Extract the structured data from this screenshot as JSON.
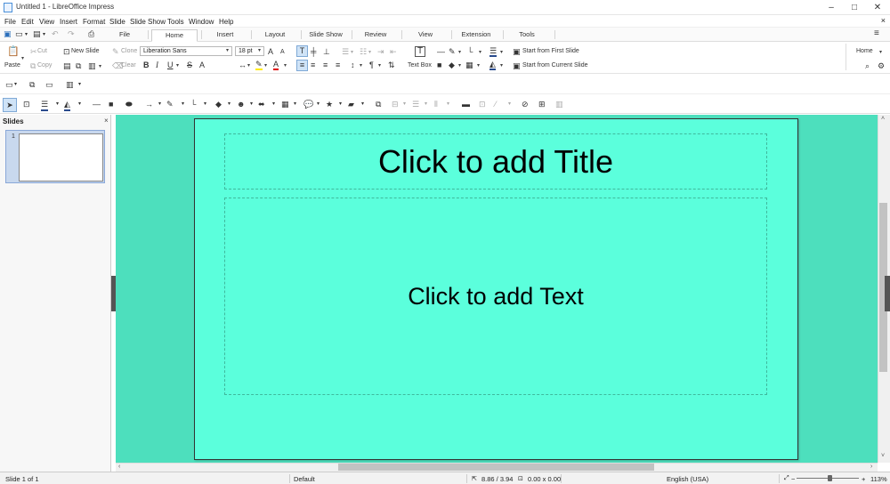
{
  "window": {
    "title": "Untitled 1 - LibreOffice Impress",
    "minimize": "–",
    "maximize": "□",
    "close": "✕"
  },
  "menu": {
    "items": [
      "File",
      "Edit",
      "View",
      "Insert",
      "Format",
      "Slide",
      "Slide Show",
      "Tools",
      "Window",
      "Help"
    ],
    "close_doc": "×"
  },
  "tabs": {
    "items": [
      "File",
      "Home",
      "Insert",
      "Layout",
      "Slide Show",
      "Review",
      "View",
      "Extension",
      "Tools"
    ],
    "active": "Home"
  },
  "ribbon": {
    "paste": "Paste",
    "cut": "Cut",
    "copy": "Copy",
    "new_slide": "New Slide",
    "clone": "Clone",
    "clear": "Clear",
    "font_name": "Liberation Sans",
    "font_size": "18 pt",
    "text_box": "Text Box",
    "start_first": "Start from First Slide",
    "start_current": "Start from Current Slide",
    "home_select": "Home"
  },
  "slides_pane": {
    "header": "Slides",
    "close": "×",
    "slide_number": "1"
  },
  "slide": {
    "title_placeholder": "Click to add Title",
    "body_placeholder": "Click to add Text"
  },
  "status": {
    "slide": "Slide 1 of 1",
    "layout": "Default",
    "position": "8.86 / 3.94",
    "size": "0.00 x 0.00",
    "language": "English (USA)",
    "zoom_minus": "−",
    "zoom_plus": "+",
    "zoom": "113%"
  },
  "colors": {
    "workspace": "#4ddfbd",
    "slide_bg": "#5bffdc",
    "placeholder_border": "#3fb99c"
  },
  "icons": [
    "search-icon",
    "gear-icon",
    "hamburger-icon",
    "pointer-icon",
    "rectangle-icon",
    "ellipse-icon",
    "star-icon"
  ]
}
